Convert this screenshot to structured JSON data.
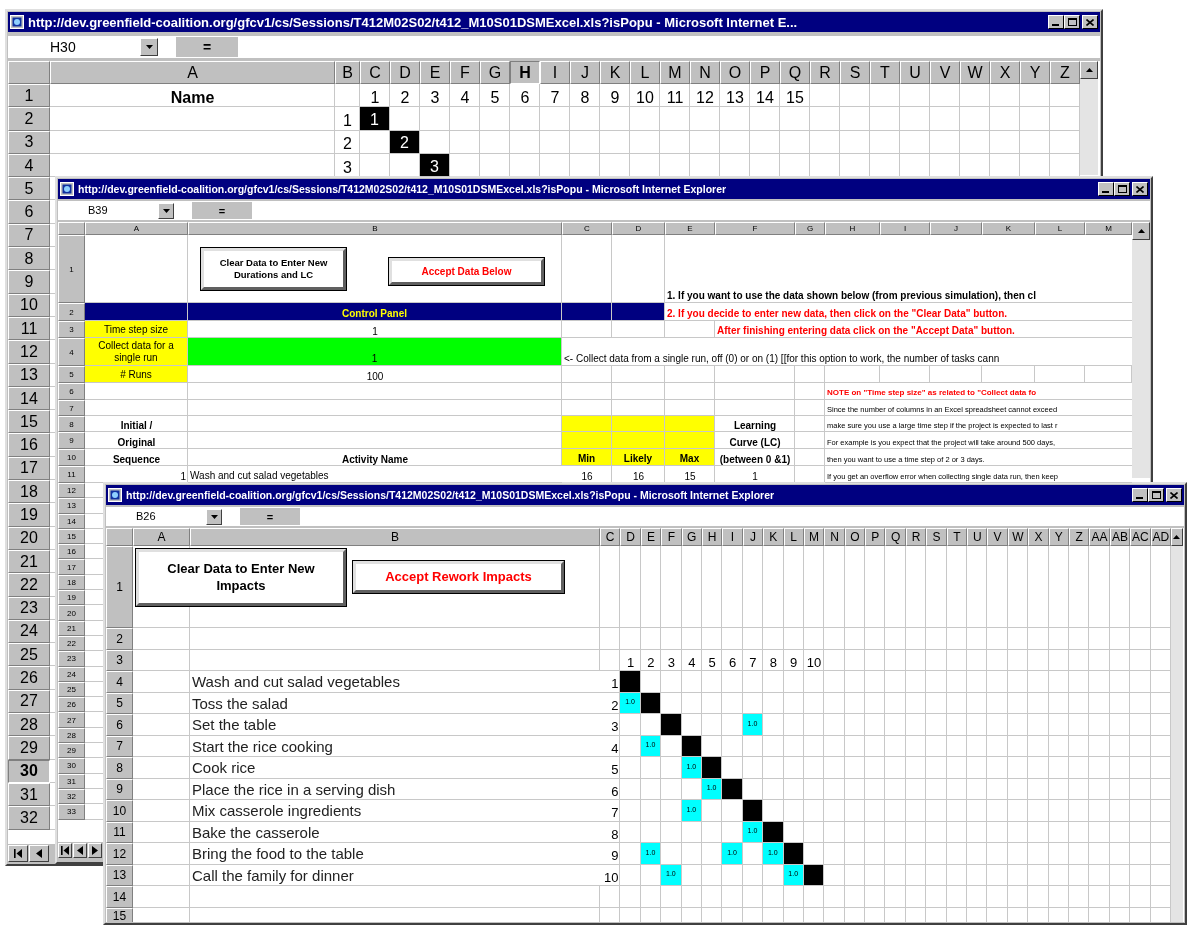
{
  "windows": [
    {
      "title": "http://dev.greenfield-coalition.org/gfcv1/cs/Sessions/T412M02S02/t412_M10S01DSMExcel.xls?isPopu - Microsoft Internet E...",
      "name_box": "H30",
      "formula_button": "=",
      "columns": [
        {
          "label": "A",
          "selected": false
        },
        {
          "label": "B",
          "selected": false
        },
        {
          "label": "C",
          "selected": false
        },
        {
          "label": "D",
          "selected": false
        },
        {
          "label": "E",
          "selected": false
        },
        {
          "label": "F",
          "selected": false
        },
        {
          "label": "G",
          "selected": false
        },
        {
          "label": "H",
          "selected": true
        },
        {
          "label": "I",
          "selected": false
        },
        {
          "label": "J",
          "selected": false
        },
        {
          "label": "K",
          "selected": false
        },
        {
          "label": "L",
          "selected": false
        },
        {
          "label": "M",
          "selected": false
        },
        {
          "label": "N",
          "selected": false
        },
        {
          "label": "O",
          "selected": false
        },
        {
          "label": "P",
          "selected": false
        },
        {
          "label": "Q",
          "selected": false
        },
        {
          "label": "R",
          "selected": false
        },
        {
          "label": "S",
          "selected": false
        },
        {
          "label": "T",
          "selected": false
        },
        {
          "label": "U",
          "selected": false
        },
        {
          "label": "V",
          "selected": false
        },
        {
          "label": "W",
          "selected": false
        },
        {
          "label": "X",
          "selected": false
        },
        {
          "label": "Y",
          "selected": false
        },
        {
          "label": "Z",
          "selected": false
        }
      ],
      "rows": [
        {
          "label": "1",
          "selected": false,
          "cells": [
            {
              "kind": "heading",
              "text": "Name"
            },
            {
              "kind": "blank"
            },
            {
              "kind": "number",
              "text": "1"
            },
            {
              "kind": "number",
              "text": "2"
            },
            {
              "kind": "number",
              "text": "3"
            },
            {
              "kind": "number",
              "text": "4"
            },
            {
              "kind": "number",
              "text": "5"
            },
            {
              "kind": "number",
              "text": "6"
            },
            {
              "kind": "number",
              "text": "7"
            },
            {
              "kind": "number",
              "text": "8"
            },
            {
              "kind": "number",
              "text": "9"
            },
            {
              "kind": "number",
              "text": "10"
            },
            {
              "kind": "number",
              "text": "11"
            },
            {
              "kind": "number",
              "text": "12"
            },
            {
              "kind": "number",
              "text": "13"
            },
            {
              "kind": "number",
              "text": "14"
            },
            {
              "kind": "number",
              "text": "15"
            }
          ]
        },
        {
          "label": "2",
          "selected": false,
          "cells": [
            {
              "kind": "blank"
            },
            {
              "kind": "number",
              "text": "1"
            },
            {
              "kind": "number",
              "text": "1",
              "color": "#000000"
            }
          ]
        },
        {
          "label": "3",
          "selected": false,
          "cells": [
            {
              "kind": "blank"
            },
            {
              "kind": "number",
              "text": "2"
            },
            {
              "kind": "blank"
            },
            {
              "kind": "number",
              "text": "2",
              "color": "#000000"
            }
          ]
        },
        {
          "label": "4",
          "selected": false,
          "cells": [
            {
              "kind": "blank"
            },
            {
              "kind": "number",
              "text": "3"
            },
            {
              "kind": "blank"
            },
            {
              "kind": "blank"
            },
            {
              "kind": "number",
              "text": "3",
              "color": "#000000"
            }
          ]
        },
        {
          "label": "5",
          "selected": false
        },
        {
          "label": "6",
          "selected": false
        },
        {
          "label": "7",
          "selected": false
        },
        {
          "label": "8",
          "selected": false
        },
        {
          "label": "9",
          "selected": false
        },
        {
          "label": "10",
          "selected": false
        },
        {
          "label": "11",
          "selected": false
        },
        {
          "label": "12",
          "selected": false
        },
        {
          "label": "13",
          "selected": false
        },
        {
          "label": "14",
          "selected": false
        },
        {
          "label": "15",
          "selected": false
        },
        {
          "label": "16",
          "selected": false
        },
        {
          "label": "17",
          "selected": false
        },
        {
          "label": "18",
          "selected": false
        },
        {
          "label": "19",
          "selected": false
        },
        {
          "label": "20",
          "selected": false
        },
        {
          "label": "21",
          "selected": false
        },
        {
          "label": "22",
          "selected": false
        },
        {
          "label": "23",
          "selected": false
        },
        {
          "label": "24",
          "selected": false
        },
        {
          "label": "25",
          "selected": false
        },
        {
          "label": "26",
          "selected": false
        },
        {
          "label": "27",
          "selected": false
        },
        {
          "label": "28",
          "selected": false
        },
        {
          "label": "29",
          "selected": false
        },
        {
          "label": "30",
          "selected": true
        },
        {
          "label": "31",
          "selected": false
        },
        {
          "label": "32",
          "selected": false
        }
      ],
      "nav_buttons": [
        {
          "kind": "first"
        },
        {
          "kind": "previous"
        }
      ]
    },
    {
      "title": "http://dev.greenfield-coalition.org/gfcv1/cs/Sessions/T412M02S02/t412_M10S01DSMExcel.xls?isPopu - Microsoft Internet Explorer",
      "name_box": "B39",
      "formula_button": "=",
      "columns": [
        {
          "label": "A",
          "selected": false
        },
        {
          "label": "B",
          "selected": false
        },
        {
          "label": "C",
          "selected": false
        },
        {
          "label": "D",
          "selected": false
        },
        {
          "label": "E",
          "selected": false
        },
        {
          "label": "F",
          "selected": false
        },
        {
          "label": "G",
          "selected": false
        },
        {
          "label": "H",
          "selected": false
        },
        {
          "label": "I",
          "selected": false
        },
        {
          "label": "J",
          "selected": false
        },
        {
          "label": "K",
          "selected": false
        },
        {
          "label": "L",
          "selected": false
        },
        {
          "label": "M",
          "selected": false
        }
      ],
      "rows": [
        {
          "label": "1",
          "selected": false,
          "cells": [
            {
              "kind": "blank"
            },
            {
              "kind": "blank"
            },
            {
              "kind": "blank"
            },
            {
              "kind": "blank"
            },
            {
              "kind": "strong",
              "text": "1. If you want to use the data shown below (from previous simulation), then cl"
            }
          ]
        },
        {
          "label": "2",
          "selected": false,
          "cells": [
            {
              "kind": "fill",
              "color": "#000080"
            },
            {
              "kind": "banner",
              "text": "Control Panel",
              "color": "#000080"
            },
            {
              "kind": "fill",
              "color": "#000080"
            },
            {
              "kind": "fill",
              "color": "#000080"
            },
            {
              "kind": "alert",
              "text": "2. If you decide to enter new data, then click on the \"Clear Data\" button."
            }
          ]
        },
        {
          "label": "3",
          "selected": false,
          "cells": [
            {
              "kind": "label",
              "text": "Time step size",
              "color": "#ffff00"
            },
            {
              "kind": "number",
              "text": "1"
            },
            {
              "kind": "blank"
            },
            {
              "kind": "blank"
            },
            {
              "kind": "blank"
            },
            {
              "kind": "alert",
              "text": "After finishing entering data click on the \"Accept Data\" button."
            }
          ]
        },
        {
          "label": "4",
          "selected": false,
          "cells": [
            {
              "kind": "label",
              "text": "Collect data for a single run",
              "color": "#ffff00"
            },
            {
              "kind": "number",
              "text": "1",
              "color": "#00ff00"
            },
            {
              "kind": "text",
              "text": "<- Collect data from a single run, off (0) or on (1) [[for this option to work, the number of tasks cann"
            }
          ]
        },
        {
          "label": "5",
          "selected": false,
          "cells": [
            {
              "kind": "label",
              "text": "# Runs",
              "color": "#ffff00"
            },
            {
              "kind": "number",
              "text": "100"
            }
          ]
        },
        {
          "label": "6",
          "selected": false,
          "cells": [
            {
              "kind": "blank"
            },
            {
              "kind": "blank"
            },
            {
              "kind": "blank"
            },
            {
              "kind": "blank"
            },
            {
              "kind": "blank"
            },
            {
              "kind": "blank"
            },
            {
              "kind": "blank"
            },
            {
              "kind": "alert-note",
              "text": "NOTE on \"Time step size\" as related to \"Collect data fo"
            }
          ]
        },
        {
          "label": "7",
          "selected": false,
          "cells": [
            {
              "kind": "blank"
            },
            {
              "kind": "blank"
            },
            {
              "kind": "blank"
            },
            {
              "kind": "blank"
            },
            {
              "kind": "blank"
            },
            {
              "kind": "blank"
            },
            {
              "kind": "blank"
            },
            {
              "kind": "note",
              "text": "Since the number of columns in an Excel spreadsheet cannot exceed"
            }
          ]
        },
        {
          "label": "8",
          "selected": false,
          "cells": [
            {
              "kind": "heading",
              "text": "Initial /"
            },
            {
              "kind": "blank"
            },
            {
              "kind": "fill",
              "color": "#ffff00"
            },
            {
              "kind": "fill",
              "color": "#ffff00"
            },
            {
              "kind": "fill",
              "color": "#ffff00"
            },
            {
              "kind": "heading",
              "text": "Learning"
            },
            {
              "kind": "blank"
            },
            {
              "kind": "note",
              "text": "make sure you use a large time step if the project is expected to last r"
            }
          ]
        },
        {
          "label": "9",
          "selected": false,
          "cells": [
            {
              "kind": "heading",
              "text": "Original"
            },
            {
              "kind": "blank"
            },
            {
              "kind": "fill",
              "color": "#ffff00"
            },
            {
              "kind": "fill",
              "color": "#ffff00"
            },
            {
              "kind": "fill",
              "color": "#ffff00"
            },
            {
              "kind": "heading",
              "text": "Curve (LC)"
            },
            {
              "kind": "blank"
            },
            {
              "kind": "note",
              "text": "For example is you expect that the project will take around 500 days,"
            }
          ]
        },
        {
          "label": "10",
          "selected": false,
          "cells": [
            {
              "kind": "heading",
              "text": "Sequence"
            },
            {
              "kind": "heading",
              "text": "Activity Name"
            },
            {
              "kind": "heading",
              "text": "Min",
              "color": "#ffff00"
            },
            {
              "kind": "heading",
              "text": "Likely",
              "color": "#ffff00"
            },
            {
              "kind": "heading",
              "text": "Max",
              "color": "#ffff00"
            },
            {
              "kind": "heading",
              "text": "(between 0 &1)"
            },
            {
              "kind": "blank"
            },
            {
              "kind": "note",
              "text": "then you want to use a time step of 2 or 3 days."
            }
          ]
        },
        {
          "label": "11",
          "selected": false,
          "cells": [
            {
              "kind": "index",
              "text": "1"
            },
            {
              "kind": "text",
              "text": "Wash and cut salad vegetables"
            },
            {
              "kind": "number",
              "text": "16"
            },
            {
              "kind": "number",
              "text": "16"
            },
            {
              "kind": "number",
              "text": "15"
            },
            {
              "kind": "number",
              "text": "1"
            },
            {
              "kind": "blank"
            },
            {
              "kind": "note",
              "text": "If you get an overflow error when collecting single data run, then keep"
            }
          ]
        },
        {
          "label": "12",
          "selected": false
        },
        {
          "label": "13",
          "selected": false
        },
        {
          "label": "14",
          "selected": false
        },
        {
          "label": "15",
          "selected": false
        },
        {
          "label": "16",
          "selected": false
        },
        {
          "label": "17",
          "selected": false
        },
        {
          "label": "18",
          "selected": false
        },
        {
          "label": "19",
          "selected": false
        },
        {
          "label": "20",
          "selected": false
        },
        {
          "label": "21",
          "selected": false
        },
        {
          "label": "22",
          "selected": false
        },
        {
          "label": "23",
          "selected": false
        },
        {
          "label": "24",
          "selected": false
        },
        {
          "label": "25",
          "selected": false
        },
        {
          "label": "26",
          "selected": false
        },
        {
          "label": "27",
          "selected": false
        },
        {
          "label": "28",
          "selected": false
        },
        {
          "label": "29",
          "selected": false
        },
        {
          "label": "30",
          "selected": false
        },
        {
          "label": "31",
          "selected": false
        },
        {
          "label": "32",
          "selected": false
        },
        {
          "label": "33",
          "selected": false
        }
      ],
      "buttons": [
        {
          "label": "Clear Data to Enter New Durations and LC",
          "kind": "plain"
        },
        {
          "label": "Accept Data Below",
          "kind": "accept"
        }
      ],
      "nav_buttons": [
        {
          "kind": "first"
        },
        {
          "kind": "previous"
        },
        {
          "kind": "next"
        }
      ]
    },
    {
      "title": "http://dev.greenfield-coalition.org/gfcv1/cs/Sessions/T412M02S02/t412_M10S01DSMExcel.xls?isPopu - Microsoft Internet Explorer",
      "name_box": "B26",
      "formula_button": "=",
      "columns": [
        {
          "label": "A",
          "selected": false
        },
        {
          "label": "B",
          "selected": false
        },
        {
          "label": "C",
          "selected": false
        },
        {
          "label": "D",
          "selected": false
        },
        {
          "label": "E",
          "selected": false
        },
        {
          "label": "F",
          "selected": false
        },
        {
          "label": "G",
          "selected": false
        },
        {
          "label": "H",
          "selected": false
        },
        {
          "label": "I",
          "selected": false
        },
        {
          "label": "J",
          "selected": false
        },
        {
          "label": "K",
          "selected": false
        },
        {
          "label": "L",
          "selected": false
        },
        {
          "label": "M",
          "selected": false
        },
        {
          "label": "N",
          "selected": false
        },
        {
          "label": "O",
          "selected": false
        },
        {
          "label": "P",
          "selected": false
        },
        {
          "label": "Q",
          "selected": false
        },
        {
          "label": "R",
          "selected": false
        },
        {
          "label": "S",
          "selected": false
        },
        {
          "label": "T",
          "selected": false
        },
        {
          "label": "U",
          "selected": false
        },
        {
          "label": "V",
          "selected": false
        },
        {
          "label": "W",
          "selected": false
        },
        {
          "label": "X",
          "selected": false
        },
        {
          "label": "Y",
          "selected": false
        },
        {
          "label": "Z",
          "selected": false
        },
        {
          "label": "AA",
          "selected": false
        },
        {
          "label": "AB",
          "selected": false
        },
        {
          "label": "AC",
          "selected": false
        },
        {
          "label": "AD",
          "selected": false
        }
      ],
      "rows": [
        {
          "label": "1",
          "selected": false
        },
        {
          "label": "2",
          "selected": false
        },
        {
          "label": "3",
          "selected": false,
          "cells": [
            {
              "kind": "blank"
            },
            {
              "kind": "blank"
            },
            {
              "kind": "blank"
            },
            {
              "kind": "number",
              "text": "1"
            },
            {
              "kind": "number",
              "text": "2"
            },
            {
              "kind": "number",
              "text": "3"
            },
            {
              "kind": "number",
              "text": "4"
            },
            {
              "kind": "number",
              "text": "5"
            },
            {
              "kind": "number",
              "text": "6"
            },
            {
              "kind": "number",
              "text": "7"
            },
            {
              "kind": "number",
              "text": "8"
            },
            {
              "kind": "number",
              "text": "9"
            },
            {
              "kind": "number",
              "text": "10"
            }
          ]
        },
        {
          "label": "4",
          "selected": false,
          "cells": [
            {
              "kind": "blank"
            },
            {
              "kind": "text",
              "text": "Wash and cut salad vegetables"
            },
            {
              "kind": "index",
              "text": "1"
            },
            {
              "kind": "fill",
              "color": "#000000"
            }
          ]
        },
        {
          "label": "5",
          "selected": false,
          "cells": [
            {
              "kind": "blank"
            },
            {
              "kind": "text",
              "text": "Toss the salad"
            },
            {
              "kind": "index",
              "text": "2"
            },
            {
              "kind": "matrix",
              "text": "1.0",
              "color": "#00ffff"
            },
            {
              "kind": "fill",
              "color": "#000000"
            }
          ]
        },
        {
          "label": "6",
          "selected": false,
          "cells": [
            {
              "kind": "blank"
            },
            {
              "kind": "text",
              "text": "Set the table"
            },
            {
              "kind": "index",
              "text": "3"
            },
            {
              "kind": "blank"
            },
            {
              "kind": "blank"
            },
            {
              "kind": "fill",
              "color": "#000000"
            },
            {
              "kind": "blank"
            },
            {
              "kind": "blank"
            },
            {
              "kind": "blank"
            },
            {
              "kind": "matrix",
              "text": "1.0",
              "color": "#00ffff"
            }
          ]
        },
        {
          "label": "7",
          "selected": false,
          "cells": [
            {
              "kind": "blank"
            },
            {
              "kind": "text",
              "text": "Start the rice cooking"
            },
            {
              "kind": "index",
              "text": "4"
            },
            {
              "kind": "blank"
            },
            {
              "kind": "matrix",
              "text": "1.0",
              "color": "#00ffff"
            },
            {
              "kind": "blank"
            },
            {
              "kind": "fill",
              "color": "#000000"
            }
          ]
        },
        {
          "label": "8",
          "selected": false,
          "cells": [
            {
              "kind": "blank"
            },
            {
              "kind": "text",
              "text": "Cook rice"
            },
            {
              "kind": "index",
              "text": "5"
            },
            {
              "kind": "blank"
            },
            {
              "kind": "blank"
            },
            {
              "kind": "blank"
            },
            {
              "kind": "matrix",
              "text": "1.0",
              "color": "#00ffff"
            },
            {
              "kind": "fill",
              "color": "#000000"
            }
          ]
        },
        {
          "label": "9",
          "selected": false,
          "cells": [
            {
              "kind": "blank"
            },
            {
              "kind": "text",
              "text": "Place the rice in a serving dish"
            },
            {
              "kind": "index",
              "text": "6"
            },
            {
              "kind": "blank"
            },
            {
              "kind": "blank"
            },
            {
              "kind": "blank"
            },
            {
              "kind": "blank"
            },
            {
              "kind": "matrix",
              "text": "1.0",
              "color": "#00ffff"
            },
            {
              "kind": "fill",
              "color": "#000000"
            }
          ]
        },
        {
          "label": "10",
          "selected": false,
          "cells": [
            {
              "kind": "blank"
            },
            {
              "kind": "text",
              "text": "Mix casserole ingredients"
            },
            {
              "kind": "index",
              "text": "7"
            },
            {
              "kind": "blank"
            },
            {
              "kind": "blank"
            },
            {
              "kind": "blank"
            },
            {
              "kind": "matrix",
              "text": "1.0",
              "color": "#00ffff"
            },
            {
              "kind": "blank"
            },
            {
              "kind": "blank"
            },
            {
              "kind": "fill",
              "color": "#000000"
            }
          ]
        },
        {
          "label": "11",
          "selected": false,
          "cells": [
            {
              "kind": "blank"
            },
            {
              "kind": "text",
              "text": "Bake the casserole"
            },
            {
              "kind": "index",
              "text": "8"
            },
            {
              "kind": "blank"
            },
            {
              "kind": "blank"
            },
            {
              "kind": "blank"
            },
            {
              "kind": "blank"
            },
            {
              "kind": "blank"
            },
            {
              "kind": "blank"
            },
            {
              "kind": "matrix",
              "text": "1.0",
              "color": "#00ffff"
            },
            {
              "kind": "fill",
              "color": "#000000"
            }
          ]
        },
        {
          "label": "12",
          "selected": false,
          "cells": [
            {
              "kind": "blank"
            },
            {
              "kind": "text",
              "text": "Bring the food to the table"
            },
            {
              "kind": "index",
              "text": "9"
            },
            {
              "kind": "blank"
            },
            {
              "kind": "matrix",
              "text": "1.0",
              "color": "#00ffff"
            },
            {
              "kind": "blank"
            },
            {
              "kind": "blank"
            },
            {
              "kind": "blank"
            },
            {
              "kind": "matrix",
              "text": "1.0",
              "color": "#00ffff"
            },
            {
              "kind": "blank"
            },
            {
              "kind": "matrix",
              "text": "1.0",
              "color": "#00ffff"
            },
            {
              "kind": "fill",
              "color": "#000000"
            }
          ]
        },
        {
          "label": "13",
          "selected": false,
          "cells": [
            {
              "kind": "blank"
            },
            {
              "kind": "text",
              "text": "Call the family for dinner"
            },
            {
              "kind": "index",
              "text": "10"
            },
            {
              "kind": "blank"
            },
            {
              "kind": "blank"
            },
            {
              "kind": "matrix",
              "text": "1.0",
              "color": "#00ffff"
            },
            {
              "kind": "blank"
            },
            {
              "kind": "blank"
            },
            {
              "kind": "blank"
            },
            {
              "kind": "blank"
            },
            {
              "kind": "blank"
            },
            {
              "kind": "matrix",
              "text": "1.0",
              "color": "#00ffff"
            },
            {
              "kind": "fill",
              "color": "#000000"
            }
          ]
        },
        {
          "label": "14",
          "selected": false
        },
        {
          "label": "15",
          "selected": false
        }
      ],
      "buttons": [
        {
          "label": "Clear Data to Enter New Impacts",
          "kind": "plain"
        },
        {
          "label": "Accept Rework Impacts",
          "kind": "accept"
        }
      ]
    }
  ]
}
